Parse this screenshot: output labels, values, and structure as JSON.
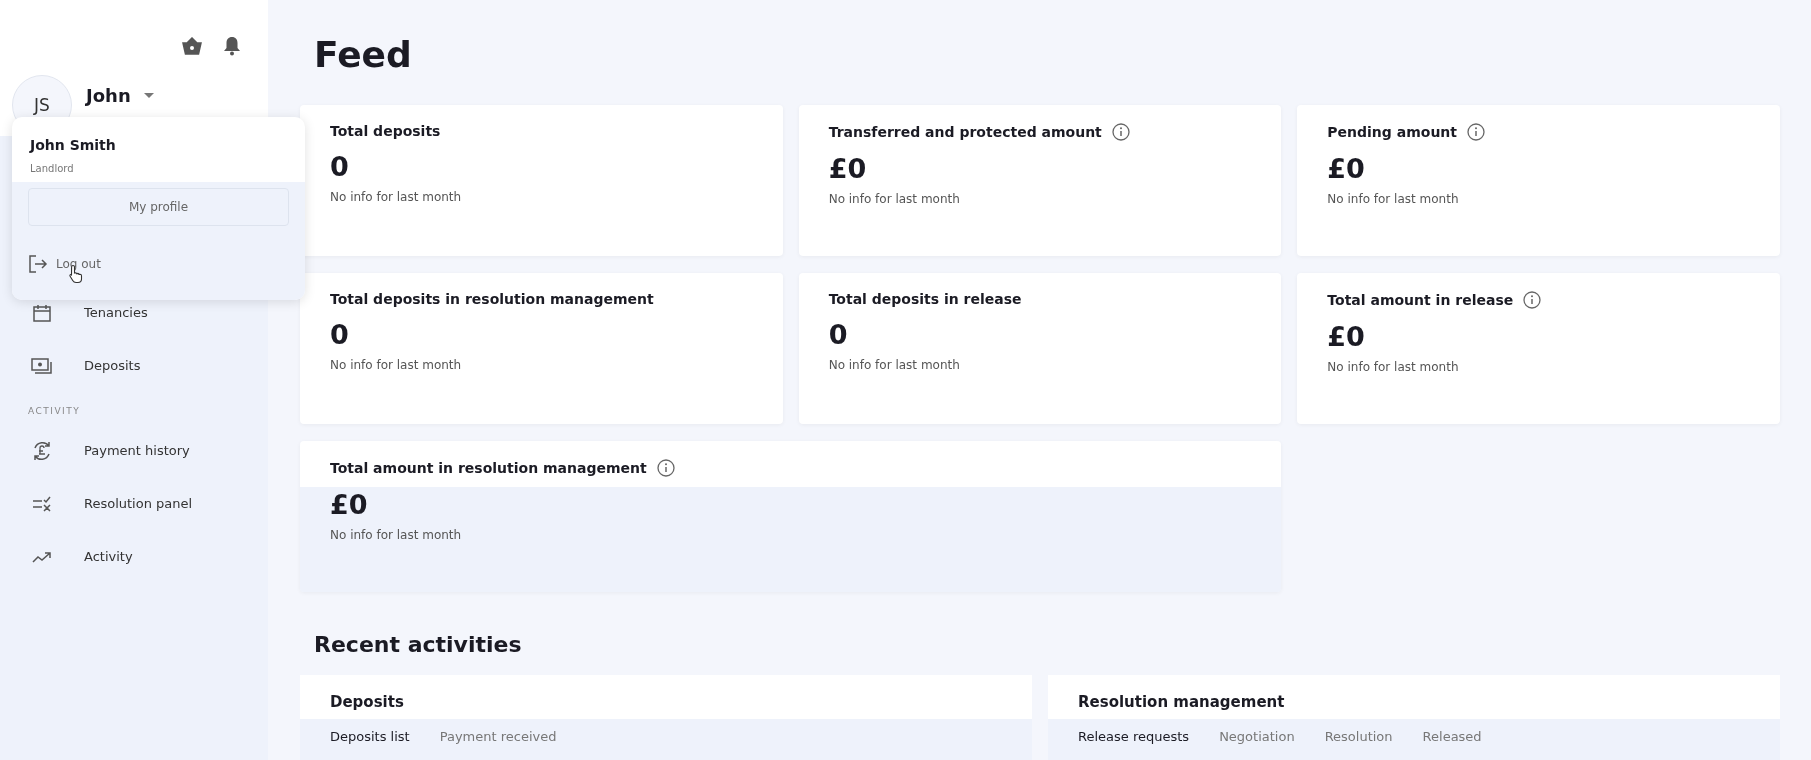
{
  "user": {
    "initials": "JS",
    "name": "John"
  },
  "menu": {
    "full_name": "John Smith",
    "role": "Landlord",
    "profile_button": "My profile",
    "logout": "Log out"
  },
  "nav": [
    {
      "kind": "item",
      "label": "Tenancies"
    },
    {
      "kind": "item",
      "label": "Deposits"
    },
    {
      "kind": "header",
      "label": "ACTIVITY"
    },
    {
      "kind": "item",
      "label": "Payment history"
    },
    {
      "kind": "item",
      "label": "Resolution panel"
    },
    {
      "kind": "item",
      "label": "Activity"
    }
  ],
  "title": "Feed",
  "cards": [
    {
      "title": "Total deposits",
      "info": false,
      "value": "0",
      "note": "No info for last month"
    },
    {
      "title": "Transferred and protected amount",
      "info": true,
      "value": "£0",
      "note": "No info for last month"
    },
    {
      "title": "Pending amount",
      "info": true,
      "value": "£0",
      "note": "No info for last month"
    },
    {
      "title": "Total deposits in resolution management",
      "info": false,
      "value": "0",
      "note": "No info for last month"
    },
    {
      "title": "Total deposits in release",
      "info": false,
      "value": "0",
      "note": "No info for last month"
    },
    {
      "title": "Total amount in release",
      "info": true,
      "value": "£0",
      "note": "No info for last month"
    },
    {
      "title": "Total amount in resolution management",
      "info": true,
      "value": "£0",
      "note": "No info for last month"
    }
  ],
  "recent_title": "Recent activities",
  "panels": [
    {
      "title": "Deposits",
      "tabs": [
        {
          "label": "Deposits list",
          "selected": true
        },
        {
          "label": "Payment received",
          "selected": false
        }
      ]
    },
    {
      "title": "Resolution management",
      "tabs": [
        {
          "label": "Release requests",
          "selected": true
        },
        {
          "label": "Negotiation",
          "selected": false
        },
        {
          "label": "Resolution",
          "selected": false
        },
        {
          "label": "Released",
          "selected": false
        }
      ]
    }
  ]
}
